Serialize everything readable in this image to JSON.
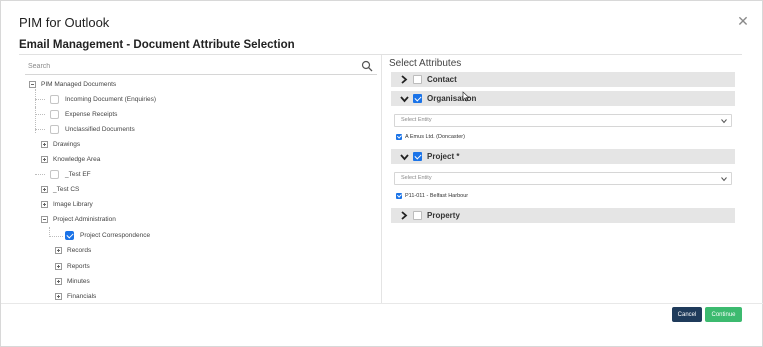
{
  "app_title": "PIM for Outlook",
  "subtitle": "Email Management - Document Attribute Selection",
  "search": {
    "placeholder": "Search"
  },
  "tree": {
    "root": "PIM Managed Documents",
    "items": [
      {
        "label": "Incoming Document (Enquiries)",
        "kind": "checkbox",
        "checked": false
      },
      {
        "label": "Expense Receipts",
        "kind": "checkbox",
        "checked": false
      },
      {
        "label": "Unclassified Documents",
        "kind": "checkbox",
        "checked": false
      },
      {
        "label": "Drawings",
        "kind": "expander"
      },
      {
        "label": "Knowledge Area",
        "kind": "expander"
      },
      {
        "label": "_Test EF",
        "kind": "checkbox",
        "checked": false
      },
      {
        "label": "_Test CS",
        "kind": "expander"
      },
      {
        "label": "Image Library",
        "kind": "expander"
      },
      {
        "label": "Project Administration",
        "kind": "expander-open"
      },
      {
        "label": "Project Correspondence",
        "kind": "checkbox",
        "checked": true
      },
      {
        "label": "Records",
        "kind": "expander"
      },
      {
        "label": "Reports",
        "kind": "expander"
      },
      {
        "label": "Minutes",
        "kind": "expander"
      },
      {
        "label": "Financials",
        "kind": "expander"
      }
    ]
  },
  "attributes": {
    "heading": "Select Attributes",
    "sections": [
      {
        "label": "Contact",
        "checked": false,
        "expanded": false
      },
      {
        "label": "Organisation",
        "checked": true,
        "expanded": true,
        "select_placeholder": "Select Entity",
        "entity": "A Emus Ltd. (Doncaster)"
      },
      {
        "label": "Project *",
        "checked": true,
        "expanded": true,
        "select_placeholder": "Select Entity",
        "entity": "P11-011 - Belfast Harbour"
      },
      {
        "label": "Property",
        "checked": false,
        "expanded": false
      }
    ]
  },
  "buttons": {
    "cancel": "Cancel",
    "continue": "Continue"
  },
  "colors": {
    "primary_check": "#1a73e8",
    "cancel_btn": "#1f3b5b",
    "continue_btn": "#3cba6f",
    "section_bar": "#e5e5e5"
  },
  "icons": {
    "close": "close-icon",
    "search": "search-icon",
    "chevron_right": "chevron-right-icon",
    "chevron_down": "chevron-down-icon"
  }
}
